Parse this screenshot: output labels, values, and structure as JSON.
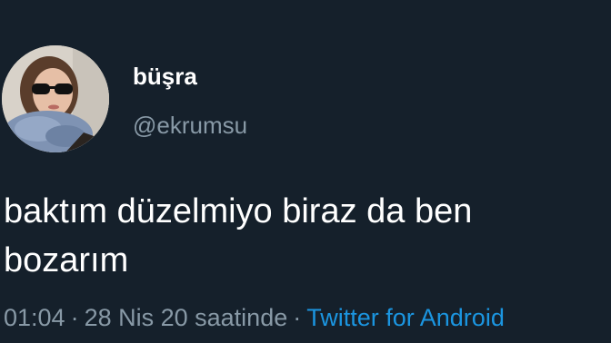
{
  "author": {
    "display_name": "büşra",
    "handle": "@ekrumsu"
  },
  "tweet": {
    "text": "baktım düzelmiyo biraz da ben bozarım",
    "time": "01:04",
    "date": "28 Nis 20 saatinde",
    "source": "Twitter for Android",
    "separator": "·"
  },
  "colors": {
    "background": "#15202b",
    "text_primary": "#ffffff",
    "text_secondary": "#8899a6",
    "link": "#1b95e0"
  }
}
